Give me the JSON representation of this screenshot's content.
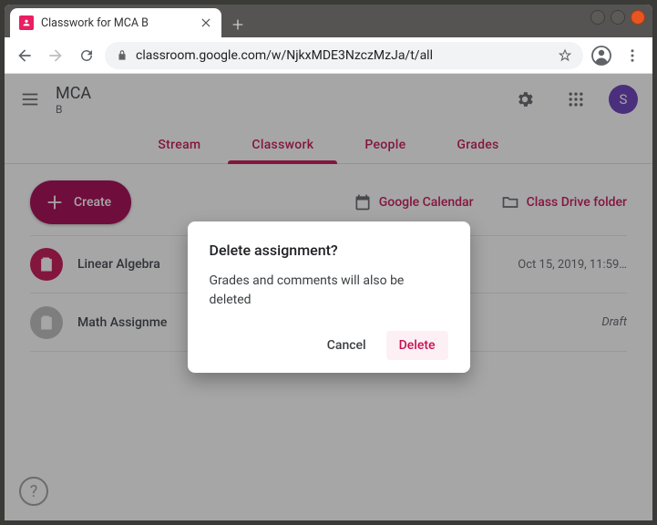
{
  "browser": {
    "tab_title": "Classwork for MCA B",
    "url": "classroom.google.com/w/NjkxMDE3NzczMzJa/t/all"
  },
  "header": {
    "class_name": "MCA",
    "section": "B",
    "avatar_initial": "S"
  },
  "nav_tabs": {
    "stream": "Stream",
    "classwork": "Classwork",
    "people": "People",
    "grades": "Grades"
  },
  "toolbar": {
    "create_label": "Create",
    "calendar_label": "Google Calendar",
    "drive_label": "Class Drive folder"
  },
  "assignments": [
    {
      "title": "Linear Algebra",
      "meta": "Oct 15, 2019, 11:59…",
      "state": "pub"
    },
    {
      "title": "Math Assignme",
      "meta": "Draft",
      "state": "draft"
    }
  ],
  "dialog": {
    "title": "Delete assignment?",
    "body": "Grades and comments will also be deleted",
    "cancel": "Cancel",
    "delete": "Delete"
  }
}
